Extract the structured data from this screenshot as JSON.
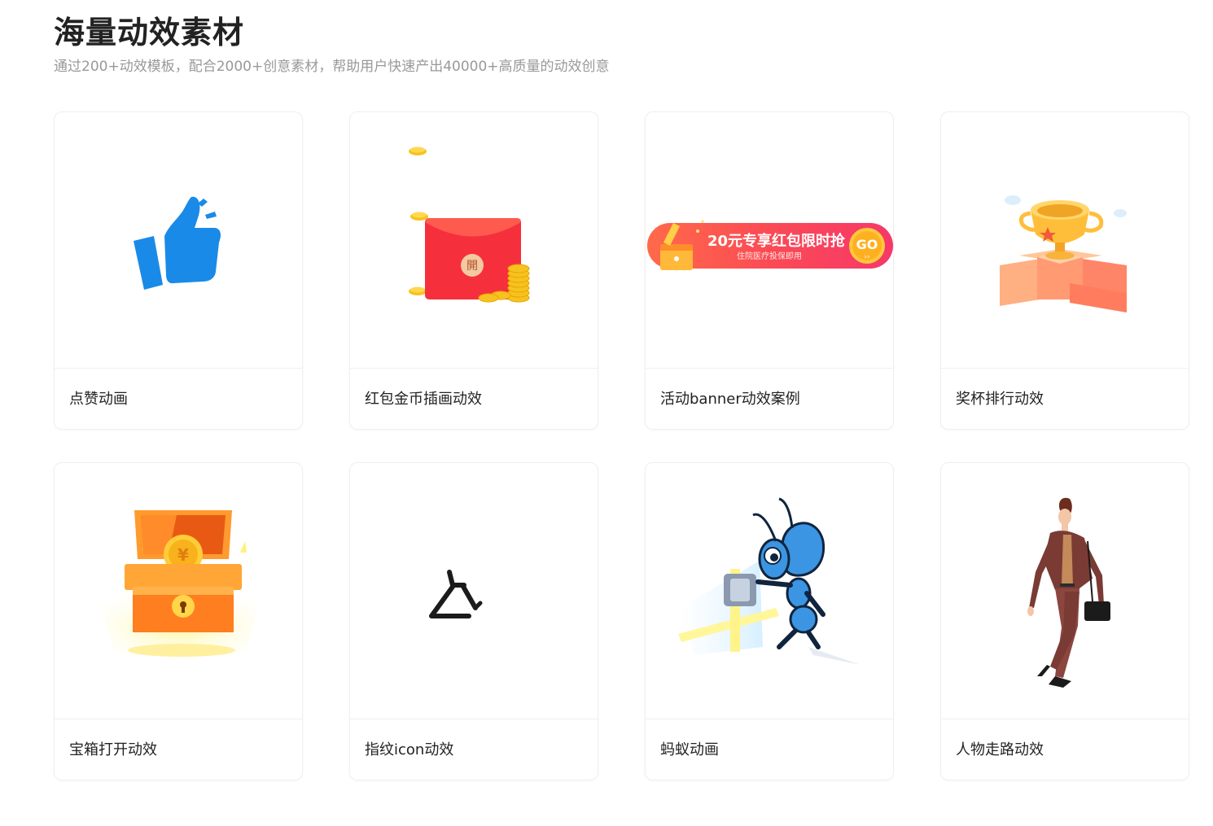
{
  "header": {
    "title": "海量动效素材",
    "subtitle": "通过200+动效模板，配合2000+创意素材，帮助用户快速产出40000+高质量的动效创意"
  },
  "cards": [
    {
      "label": "点赞动画",
      "icon": "thumbs-up-icon"
    },
    {
      "label": "红包金币插画动效",
      "icon": "red-envelope-coins-illustration",
      "envelope_char": "開"
    },
    {
      "label": "活动banner动效案例",
      "icon": "promo-banner-illustration",
      "banner_title": "20元专享红包限时抢",
      "banner_sub": "住院医疗投保即用",
      "banner_button": "GO"
    },
    {
      "label": "奖杯排行动效",
      "icon": "trophy-podium-illustration"
    },
    {
      "label": "宝箱打开动效",
      "icon": "treasure-chest-illustration",
      "coin_symbol": "¥"
    },
    {
      "label": "指纹icon动效",
      "icon": "fingerprint-icon"
    },
    {
      "label": "蚂蚁动画",
      "icon": "ant-character-illustration"
    },
    {
      "label": "人物走路动效",
      "icon": "walking-man-illustration"
    }
  ],
  "colors": {
    "title": "#222222",
    "subtitle": "#999999",
    "card_border": "#efefef",
    "thumbs_up_blue": "#1a8ae8",
    "envelope_red": "#f5303c",
    "coin_gold": "#f7c21f"
  }
}
